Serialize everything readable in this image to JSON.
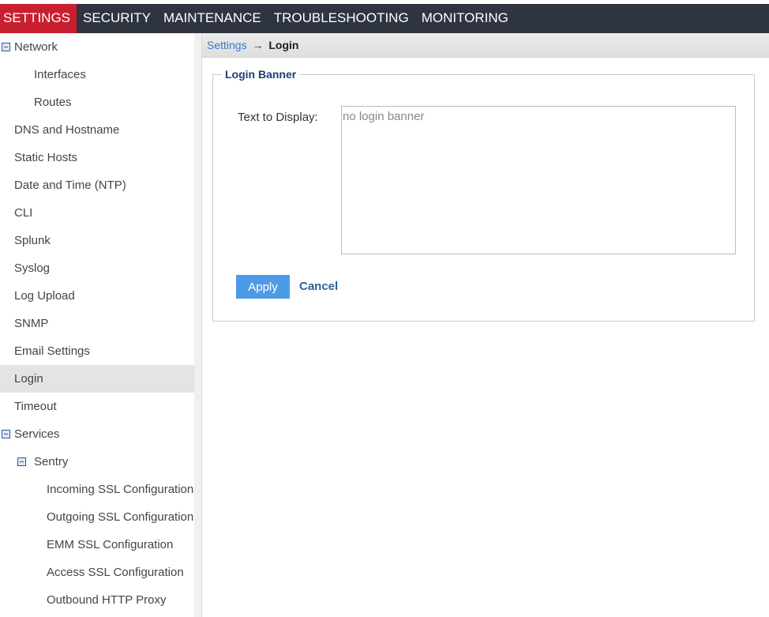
{
  "topnav": {
    "tabs": [
      {
        "label": "SETTINGS",
        "active": true
      },
      {
        "label": "SECURITY",
        "active": false
      },
      {
        "label": "MAINTENANCE",
        "active": false
      },
      {
        "label": "TROUBLESHOOTING",
        "active": false
      },
      {
        "label": "MONITORING",
        "active": false
      }
    ]
  },
  "sidebar": {
    "items": [
      {
        "label": "Network",
        "level": 0,
        "toggle": "collapse-icon"
      },
      {
        "label": "Interfaces",
        "level": 1
      },
      {
        "label": "Routes",
        "level": 1
      },
      {
        "label": "DNS and Hostname",
        "level": 0
      },
      {
        "label": "Static Hosts",
        "level": 0
      },
      {
        "label": "Date and Time (NTP)",
        "level": 0
      },
      {
        "label": "CLI",
        "level": 0
      },
      {
        "label": "Splunk",
        "level": 0
      },
      {
        "label": "Syslog",
        "level": 0
      },
      {
        "label": "Log Upload",
        "level": 0
      },
      {
        "label": "SNMP",
        "level": 0
      },
      {
        "label": "Email Settings",
        "level": 0
      },
      {
        "label": "Login",
        "level": 0,
        "selected": true
      },
      {
        "label": "Timeout",
        "level": 0
      },
      {
        "label": "Services",
        "level": 0,
        "toggle": "collapse-icon"
      },
      {
        "label": "Sentry",
        "level": 1,
        "toggle": "collapse-icon"
      },
      {
        "label": "Incoming SSL Configuration",
        "level": 2
      },
      {
        "label": "Outgoing SSL Configuration",
        "level": 2
      },
      {
        "label": "EMM SSL Configuration",
        "level": 2
      },
      {
        "label": "Access SSL Configuration",
        "level": 2
      },
      {
        "label": "Outbound HTTP Proxy",
        "level": 2
      }
    ]
  },
  "breadcrumb": {
    "parent": "Settings",
    "separator": "→",
    "current": "Login"
  },
  "login_banner": {
    "legend": "Login Banner",
    "field_label": "Text to Display:",
    "textarea_placeholder": "no login banner",
    "textarea_value": "",
    "apply_label": "Apply",
    "cancel_label": "Cancel"
  },
  "colors": {
    "topnav_bg": "#2f3540",
    "active_tab": "#c8202e",
    "apply_button": "#4d9be6",
    "link": "#2a5f9e"
  }
}
